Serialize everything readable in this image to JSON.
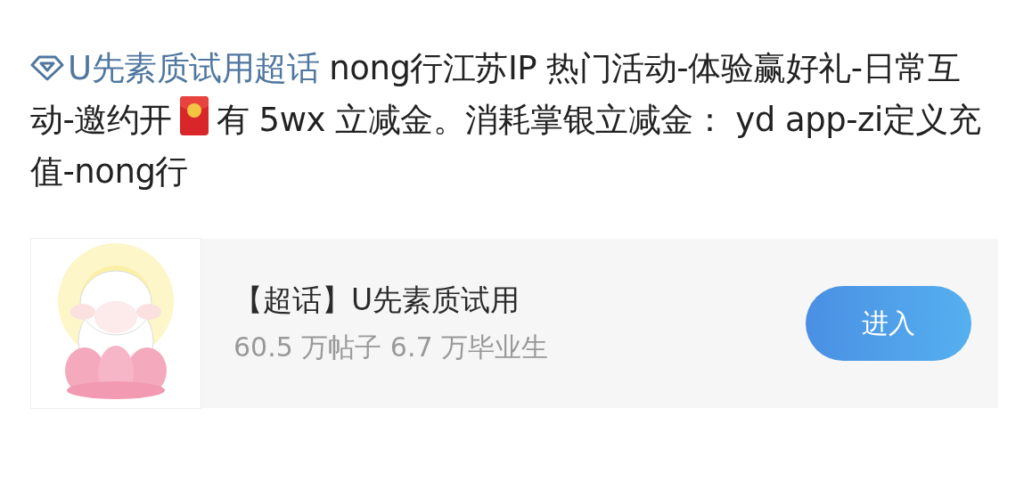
{
  "post": {
    "topic_link": "U先素质试用超话",
    "text_before_icon": " nong行江苏IP  热门活动-体验赢好礼-日常互动-邀约开",
    "text_after_icon": "有 5wx 立减金。消耗掌银立减金： yd app-zi定义充值-nong行"
  },
  "card": {
    "title": "【超话】U先素质试用",
    "stats": "60.5 万帖子 6.7 万毕业生",
    "button": "进入"
  }
}
